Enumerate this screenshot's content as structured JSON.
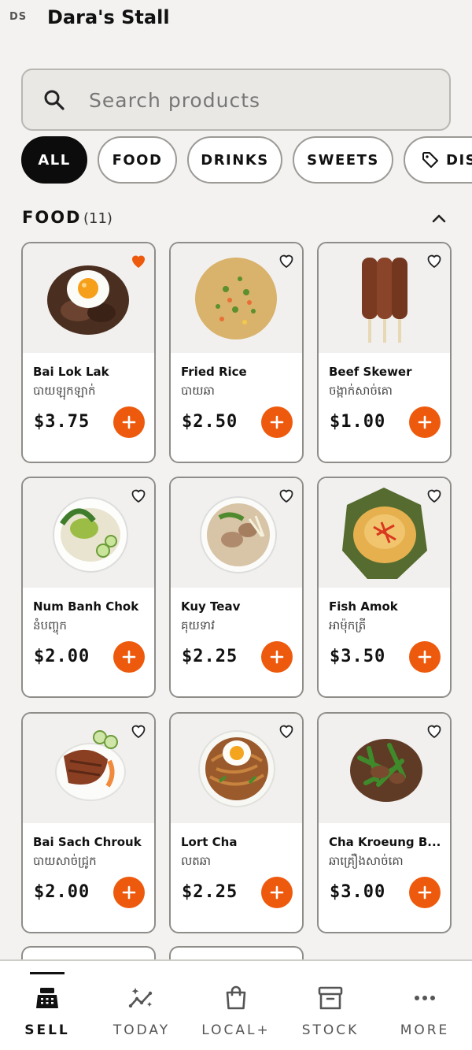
{
  "header": {
    "avatar_initials": "DS",
    "title": "Dara's Stall"
  },
  "search": {
    "placeholder": "Search products",
    "value": ""
  },
  "filters": [
    {
      "label": "ALL",
      "active": true
    },
    {
      "label": "FOOD",
      "active": false
    },
    {
      "label": "DRINKS",
      "active": false
    },
    {
      "label": "SWEETS",
      "active": false
    },
    {
      "label": "DIS",
      "active": false,
      "icon": "tag-icon"
    }
  ],
  "section": {
    "title": "FOOD",
    "count": "(11)",
    "icon": "chevron-up-icon"
  },
  "products": [
    {
      "name": "Bai Lok Lak",
      "khmer": "បាយឡុកឡាក់",
      "price": "$3.75",
      "favorite": true
    },
    {
      "name": "Fried Rice",
      "khmer": "បាយឆា",
      "price": "$2.50",
      "favorite": false
    },
    {
      "name": "Beef Skewer",
      "khmer": "ចង្កាក់សាច់គោ",
      "price": "$1.00",
      "favorite": false
    },
    {
      "name": "Num Banh Chok",
      "khmer": "នំបញ្ចុក",
      "price": "$2.00",
      "favorite": false
    },
    {
      "name": "Kuy Teav",
      "khmer": "គុយទាវ",
      "price": "$2.25",
      "favorite": false
    },
    {
      "name": "Fish Amok",
      "khmer": "អាម៉ុកត្រី",
      "price": "$3.50",
      "favorite": false
    },
    {
      "name": "Bai Sach Chrouk",
      "khmer": "បាយសាច់ជ្រូក",
      "price": "$2.00",
      "favorite": false
    },
    {
      "name": "Lort Cha",
      "khmer": "លតឆា",
      "price": "$2.25",
      "favorite": false
    },
    {
      "name": "Cha Kroeung B...",
      "khmer": "ឆាគ្រឿងសាច់គោ",
      "price": "$3.00",
      "favorite": false
    }
  ],
  "nav": [
    {
      "label": "SELL",
      "icon": "register-icon",
      "active": true
    },
    {
      "label": "TODAY",
      "icon": "sparkle-chart-icon",
      "active": false
    },
    {
      "label": "LOCAL+",
      "icon": "shopping-bag-icon",
      "active": false
    },
    {
      "label": "STOCK",
      "icon": "archive-box-icon",
      "active": false
    },
    {
      "label": "MORE",
      "icon": "more-dots-icon",
      "active": false
    }
  ],
  "colors": {
    "accent": "#ee5a0d",
    "background": "#f3f2f0",
    "chip_active": "#0c0c0c"
  }
}
